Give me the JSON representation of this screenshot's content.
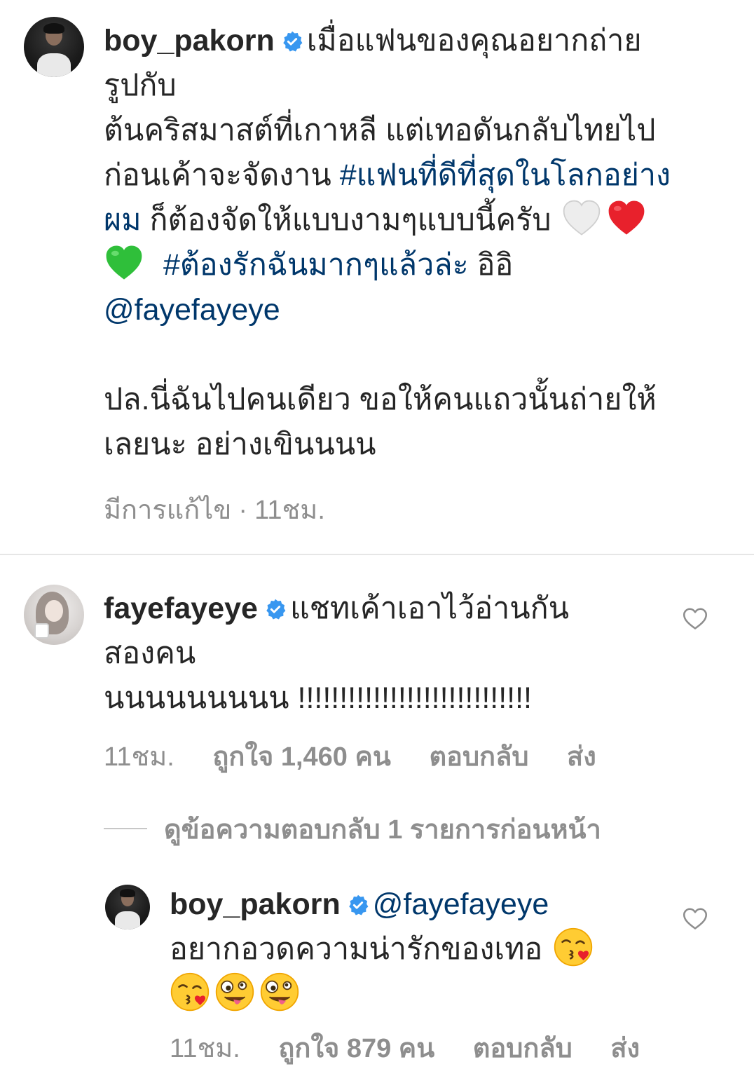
{
  "caption": {
    "username": "boy_pakorn",
    "lines": [
      "เมื่อแฟนของคุณอยากถ่าย",
      "รูปกับ",
      "ต้นคริสมาสต์ที่เกาหลี แต่เทอดันกลับไทยไป",
      "ก่อนเค้าจะจัดงาน",
      "#แฟนที่ดีที่สุดในโลกอย่าง",
      "ผม",
      "ก็ต้องจัดให้แบบงามๆแบบนี้ครับ",
      "#ต้องรักฉันมากๆแล้วล่ะ",
      "อิอิ",
      "@fayefayeye",
      "ปล.นี่ฉันไปคนเดียว ขอให้คนแถวนั้นถ่ายให้",
      "เลยนะ อย่างเขินนนน"
    ],
    "emojis": [
      "white-heart",
      "red-heart",
      "green-heart"
    ],
    "edited_label": "มีการแก้ไข",
    "time": "11ชม.",
    "separator": "·"
  },
  "comment": {
    "username": "fayefayeye",
    "lines": [
      "แชทเค้าเอาไว้อ่านกัน",
      "สองคน",
      "นนนนนนนนน !!!!!!!!!!!!!!!!!!!!!!!!!!!!"
    ],
    "time": "11ชม.",
    "likes": "ถูกใจ 1,460 คน",
    "reply_label": "ตอบกลับ",
    "send_label": "ส่ง"
  },
  "view_replies": {
    "label": "ดูข้อความตอบกลับ 1 รายการก่อนหน้า"
  },
  "reply": {
    "username": "boy_pakorn",
    "mention": "@fayefayeye",
    "line": "อยากอวดความน่ารักของเทอ",
    "emojis": [
      "kissing-heart-face",
      "kissing-heart-face",
      "zany-face",
      "zany-face"
    ],
    "time": "11ชม.",
    "likes": "ถูกใจ 879 คน",
    "reply_label": "ตอบกลับ",
    "send_label": "ส่ง"
  },
  "colors": {
    "text": "#262626",
    "secondary": "#8e8e8e",
    "link": "#00376b",
    "verified": "#3897f0"
  }
}
